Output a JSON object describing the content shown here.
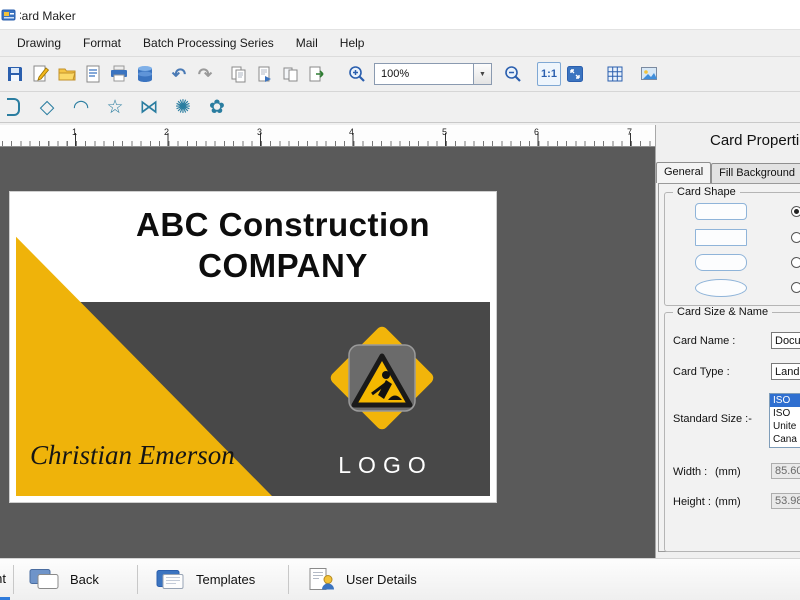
{
  "window": {
    "title": "Card Maker"
  },
  "menu": {
    "items": [
      "Drawing",
      "Format",
      "Batch Processing Series",
      "Mail",
      "Help"
    ]
  },
  "toolbar": {
    "zoom_value": "100%",
    "one_to_one_label": "1:1"
  },
  "glyphs": {
    "undo": "↶",
    "redo": "↷",
    "dropdown": "▼",
    "diamond": "◇",
    "arc": "◠",
    "star": "☆",
    "bowtie": "⋈",
    "badge": "✺",
    "seal": "✿"
  },
  "ruler": {
    "numbers": [
      "1",
      "2",
      "3",
      "4",
      "5",
      "6",
      "7"
    ]
  },
  "card": {
    "title_line1": "ABC Construction",
    "title_line2": "COMPANY",
    "signature": "Christian Emerson",
    "logo_label": "LOGO"
  },
  "panel": {
    "title": "Card Properties",
    "tabs": {
      "general": "General",
      "fill_background": "Fill Background"
    },
    "card_shape": {
      "legend": "Card Shape",
      "selected_shape_index": 0
    },
    "size_name": {
      "legend": "Card Size & Name",
      "card_name_label": "Card Name :",
      "card_name_value": "Docu",
      "card_type_label": "Card Type :",
      "card_type_value": "Land",
      "standard_size_label": "Standard Size :-",
      "standard_sizes": [
        "ISO ",
        "ISO ",
        "Unite",
        "Cana"
      ],
      "selected_size_index": 0,
      "width_label": "Width :",
      "width_unit": "(mm)",
      "width_value": "85.60",
      "height_label": "Height :",
      "height_unit": "(mm)",
      "height_value": "53.98"
    }
  },
  "bottombar": {
    "print_label": "Print",
    "back_label": "Back",
    "templates_label": "Templates",
    "user_details_label": "User Details"
  },
  "colors": {
    "accent_yellow": "#EFB30A",
    "card_dark": "#484848",
    "selection_blue": "#2f6fd0"
  }
}
